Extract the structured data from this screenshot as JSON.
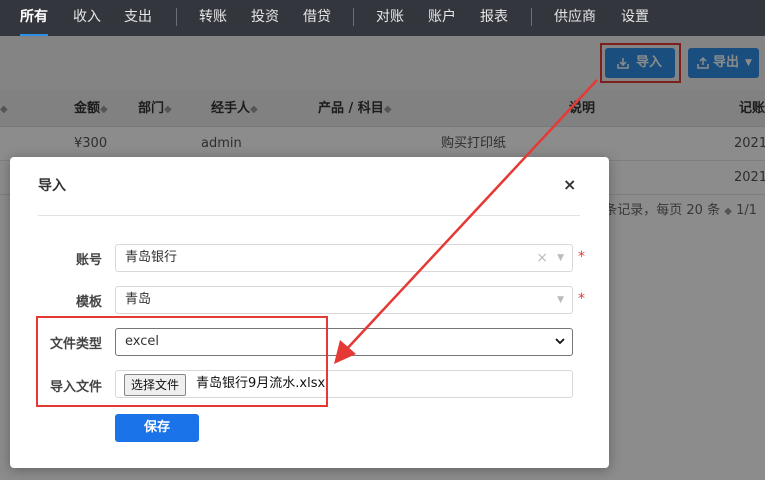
{
  "nav": {
    "items": [
      {
        "label": "所有"
      },
      {
        "label": "收入"
      },
      {
        "label": "支出"
      },
      {
        "label": "转账"
      },
      {
        "label": "投资"
      },
      {
        "label": "借贷"
      },
      {
        "label": "对账"
      },
      {
        "label": "账户"
      },
      {
        "label": "报表"
      },
      {
        "label": "供应商"
      },
      {
        "label": "设置"
      }
    ],
    "active": "所有"
  },
  "toolbar": {
    "import_label": "导入",
    "export_label": "导出"
  },
  "table": {
    "headers": {
      "amount": "金额",
      "dept": "部门",
      "handler": "经手人",
      "product": "产品 / 科目",
      "desc": "说明",
      "record": "记账"
    },
    "rows": [
      {
        "amount": "¥300",
        "handler": "admin",
        "desc": "购买打印纸",
        "date": "2021"
      },
      {
        "date": "2021"
      }
    ],
    "pager_text": "条记录，每页 20 条",
    "pager_pages": "1/1"
  },
  "modal": {
    "title": "导入",
    "close_symbol": "×",
    "account": {
      "label": "账号",
      "value": "青岛银行",
      "clear": "×",
      "required": "*"
    },
    "template": {
      "label": "模板",
      "value": "青岛",
      "required": "*"
    },
    "file_type": {
      "label": "文件类型",
      "value": "excel"
    },
    "import_file": {
      "label": "导入文件",
      "button": "选择文件",
      "filename": "青岛银行9月流水.xlsx"
    },
    "save_label": "保存"
  },
  "colors": {
    "nav_bg": "#33373d",
    "primary": "#2f8fe6",
    "save": "#1a73e8",
    "highlight": "#e53935"
  }
}
